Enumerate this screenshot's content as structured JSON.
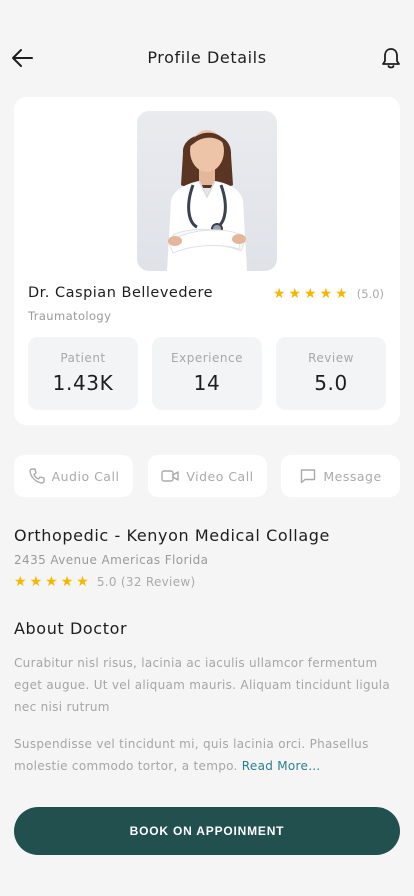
{
  "header": {
    "title": "Profile Details",
    "back_icon": "arrow-left-icon",
    "notification_icon": "bell-icon"
  },
  "doctor": {
    "name": "Dr. Caspian Bellevedere",
    "specialty": "Traumatology",
    "rating_text": "(5.0)",
    "rating_stars": 5,
    "stats": [
      {
        "label": "Patient",
        "value": "1.43K"
      },
      {
        "label": "Experience",
        "value": "14"
      },
      {
        "label": "Review",
        "value": "5.0"
      }
    ]
  },
  "actions": [
    {
      "label": "Audio Call",
      "icon": "phone-icon"
    },
    {
      "label": "Video Call",
      "icon": "video-camera-icon"
    },
    {
      "label": "Message",
      "icon": "message-icon"
    }
  ],
  "clinic": {
    "name": "Orthopedic - Kenyon  Medical Collage",
    "address": "2435 Avenue Americas Florida",
    "rating_text": "5.0 (32 Review)",
    "rating_stars": 5
  },
  "about": {
    "title": "About Doctor",
    "paragraph1": "Curabitur nisl risus, lacinia ac iaculis ullamcor fermentum eget augue. Ut vel aliquam mauris. Aliquam tincidunt ligula nec nisi rutrum",
    "paragraph2": "Suspendisse vel tincidunt mi, quis lacinia orci. Phasellus molestie commodo tortor, a tempo.",
    "read_more": "Read More…"
  },
  "book_button": "BOOK ON APPOINMENT",
  "colors": {
    "primary": "#21504f",
    "star": "#f5b700",
    "link": "#2a7f8f",
    "background": "#f5f5f5"
  }
}
